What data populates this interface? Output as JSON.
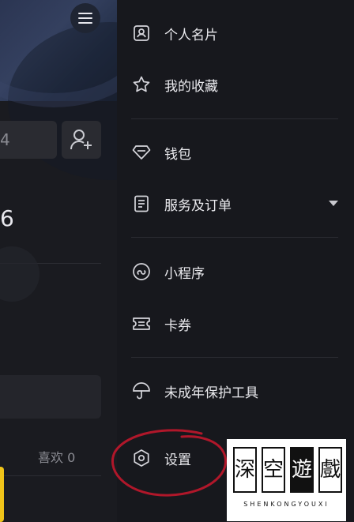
{
  "left_panel": {
    "field_fragment": "4",
    "number_fragment": "6",
    "likes_label": "喜欢 0"
  },
  "drawer": {
    "items": [
      {
        "label": "个人名片",
        "icon": "id-card-icon"
      },
      {
        "label": "我的收藏",
        "icon": "star-icon"
      },
      {
        "label": "钱包",
        "icon": "diamond-icon"
      },
      {
        "label": "服务及订单",
        "icon": "order-list-icon"
      },
      {
        "label": "小程序",
        "icon": "mini-program-icon"
      },
      {
        "label": "卡券",
        "icon": "coupon-icon"
      },
      {
        "label": "未成年保护工具",
        "icon": "umbrella-icon"
      },
      {
        "label": "设置",
        "icon": "gear-icon"
      }
    ]
  },
  "annotation": {
    "color": "#b0172a"
  },
  "watermark": {
    "characters": [
      "深",
      "空",
      "遊",
      "戲"
    ],
    "subtitle": "SHENKONGYOUXI"
  }
}
